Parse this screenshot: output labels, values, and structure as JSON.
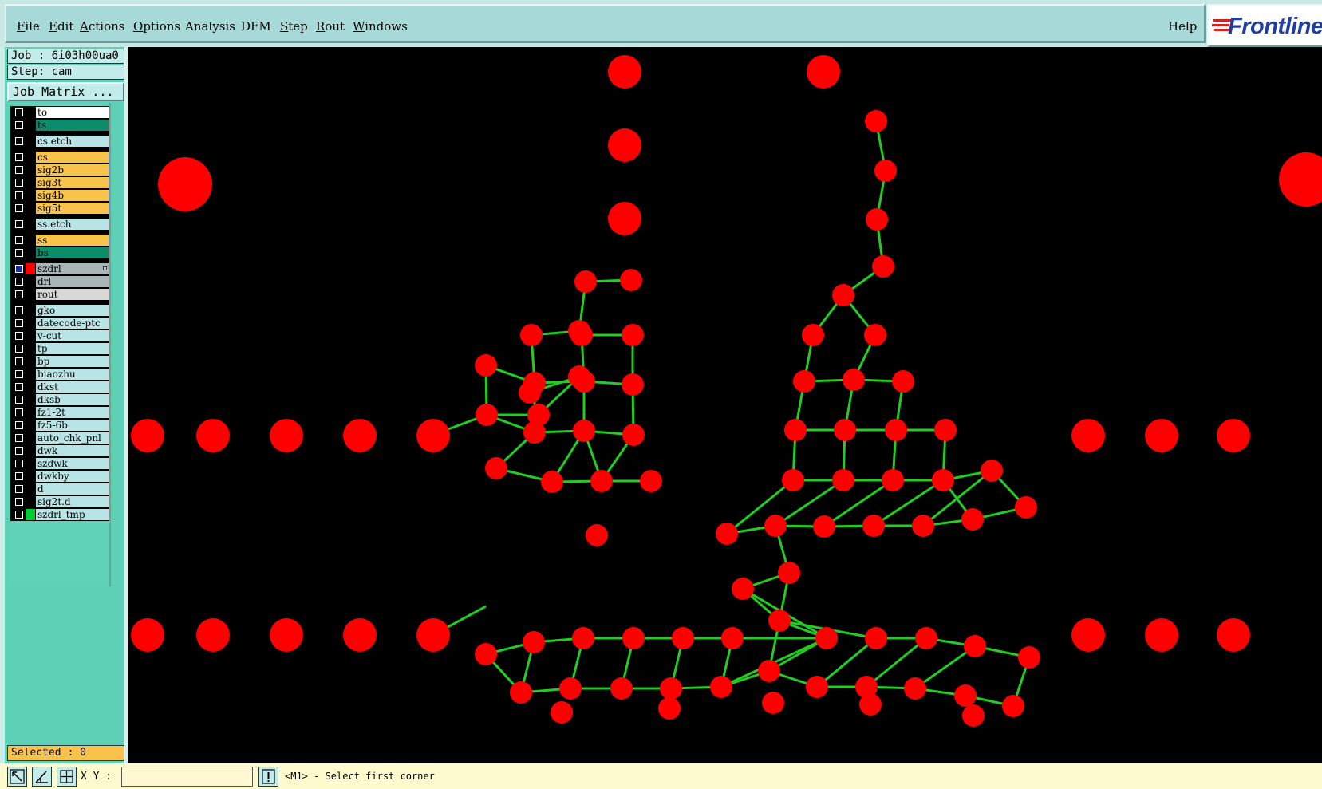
{
  "menubar": {
    "items": [
      {
        "mn": "F",
        "rest": "ile"
      },
      {
        "mn": "E",
        "rest": "dit"
      },
      {
        "mn": "A",
        "rest": "ctions"
      },
      {
        "mn": "O",
        "rest": "ptions"
      },
      {
        "mn": "",
        "rest": "Analysis"
      },
      {
        "mn": "",
        "rest": "DFM"
      },
      {
        "mn": "S",
        "rest": "tep"
      },
      {
        "mn": "R",
        "rest": "out"
      },
      {
        "mn": "W",
        "rest": "indows"
      }
    ],
    "help": "Help"
  },
  "logo": {
    "text": "Frontline",
    "color": "#1e3fa0"
  },
  "job": {
    "label": "Job : 6i03h00ua0"
  },
  "step": {
    "label": "Step: cam"
  },
  "job_matrix": {
    "label": "Job Matrix ..."
  },
  "layers": [
    [
      {
        "name": "to",
        "bg": "#ffffff",
        "color": "#000000"
      },
      {
        "name": "ts",
        "bg": "#0b8c6b",
        "color": "#000000"
      }
    ],
    [
      {
        "name": "cs.etch",
        "bg": "#b8e4e6",
        "color": "#000000"
      }
    ],
    [
      {
        "name": "cs",
        "bg": "#f9c34b",
        "color": "#000000"
      },
      {
        "name": "sig2b",
        "bg": "#f9c34b",
        "color": "#000000"
      },
      {
        "name": "sig3t",
        "bg": "#f9c34b",
        "color": "#000000"
      },
      {
        "name": "sig4b",
        "bg": "#f9c34b",
        "color": "#000000"
      },
      {
        "name": "sig5t",
        "bg": "#f9c34b",
        "color": "#000000"
      }
    ],
    [
      {
        "name": "ss.etch",
        "bg": "#b8e4e6",
        "color": "#000000"
      }
    ],
    [
      {
        "name": "ss",
        "bg": "#f9c34b",
        "color": "#000000"
      },
      {
        "name": "bs",
        "bg": "#0b8c6b",
        "color": "#000000"
      }
    ],
    [
      {
        "name": "szdrl",
        "bg": "#a9b6b8",
        "color": "#ff0000",
        "active": true,
        "marker": true
      },
      {
        "name": "drl",
        "bg": "#a9b6b8",
        "color": "#000000"
      },
      {
        "name": "rout",
        "bg": "#d8d8d8",
        "color": "#000000"
      }
    ],
    [
      {
        "name": "gko",
        "bg": "#b8e4e6",
        "color": "#000000"
      },
      {
        "name": "datecode-ptc",
        "bg": "#b8e4e6",
        "color": "#000000"
      },
      {
        "name": "v-cut",
        "bg": "#b8e4e6",
        "color": "#000000"
      },
      {
        "name": "tp",
        "bg": "#b8e4e6",
        "color": "#000000"
      },
      {
        "name": "bp",
        "bg": "#b8e4e6",
        "color": "#000000"
      },
      {
        "name": "biaozhu",
        "bg": "#b8e4e6",
        "color": "#000000"
      },
      {
        "name": "dkst",
        "bg": "#b8e4e6",
        "color": "#000000"
      },
      {
        "name": "dksb",
        "bg": "#b8e4e6",
        "color": "#000000"
      },
      {
        "name": "fz1-2t",
        "bg": "#b8e4e6",
        "color": "#000000"
      },
      {
        "name": "fz5-6b",
        "bg": "#b8e4e6",
        "color": "#000000"
      },
      {
        "name": "auto_chk_pnl",
        "bg": "#b8e4e6",
        "color": "#000000"
      },
      {
        "name": "dwk",
        "bg": "#b8e4e6",
        "color": "#000000"
      },
      {
        "name": "szdwk",
        "bg": "#b8e4e6",
        "color": "#000000"
      },
      {
        "name": "dwkby",
        "bg": "#b8e4e6",
        "color": "#000000"
      },
      {
        "name": "d",
        "bg": "#b8e4e6",
        "color": "#000000"
      },
      {
        "name": "sig2t.d",
        "bg": "#b8e4e6",
        "color": "#000000"
      },
      {
        "name": "szdrl_tmp",
        "bg": "#b8e4e6",
        "color": "#00cc33"
      }
    ]
  ],
  "selected": {
    "label": "Selected : 0"
  },
  "status": {
    "xy_label": "X Y :",
    "xy_value": "",
    "prompt": "<M1> - Select first corner"
  },
  "colors": {
    "pad": "#ff0000",
    "trace": "#22cc22",
    "canvas": "#000000"
  }
}
